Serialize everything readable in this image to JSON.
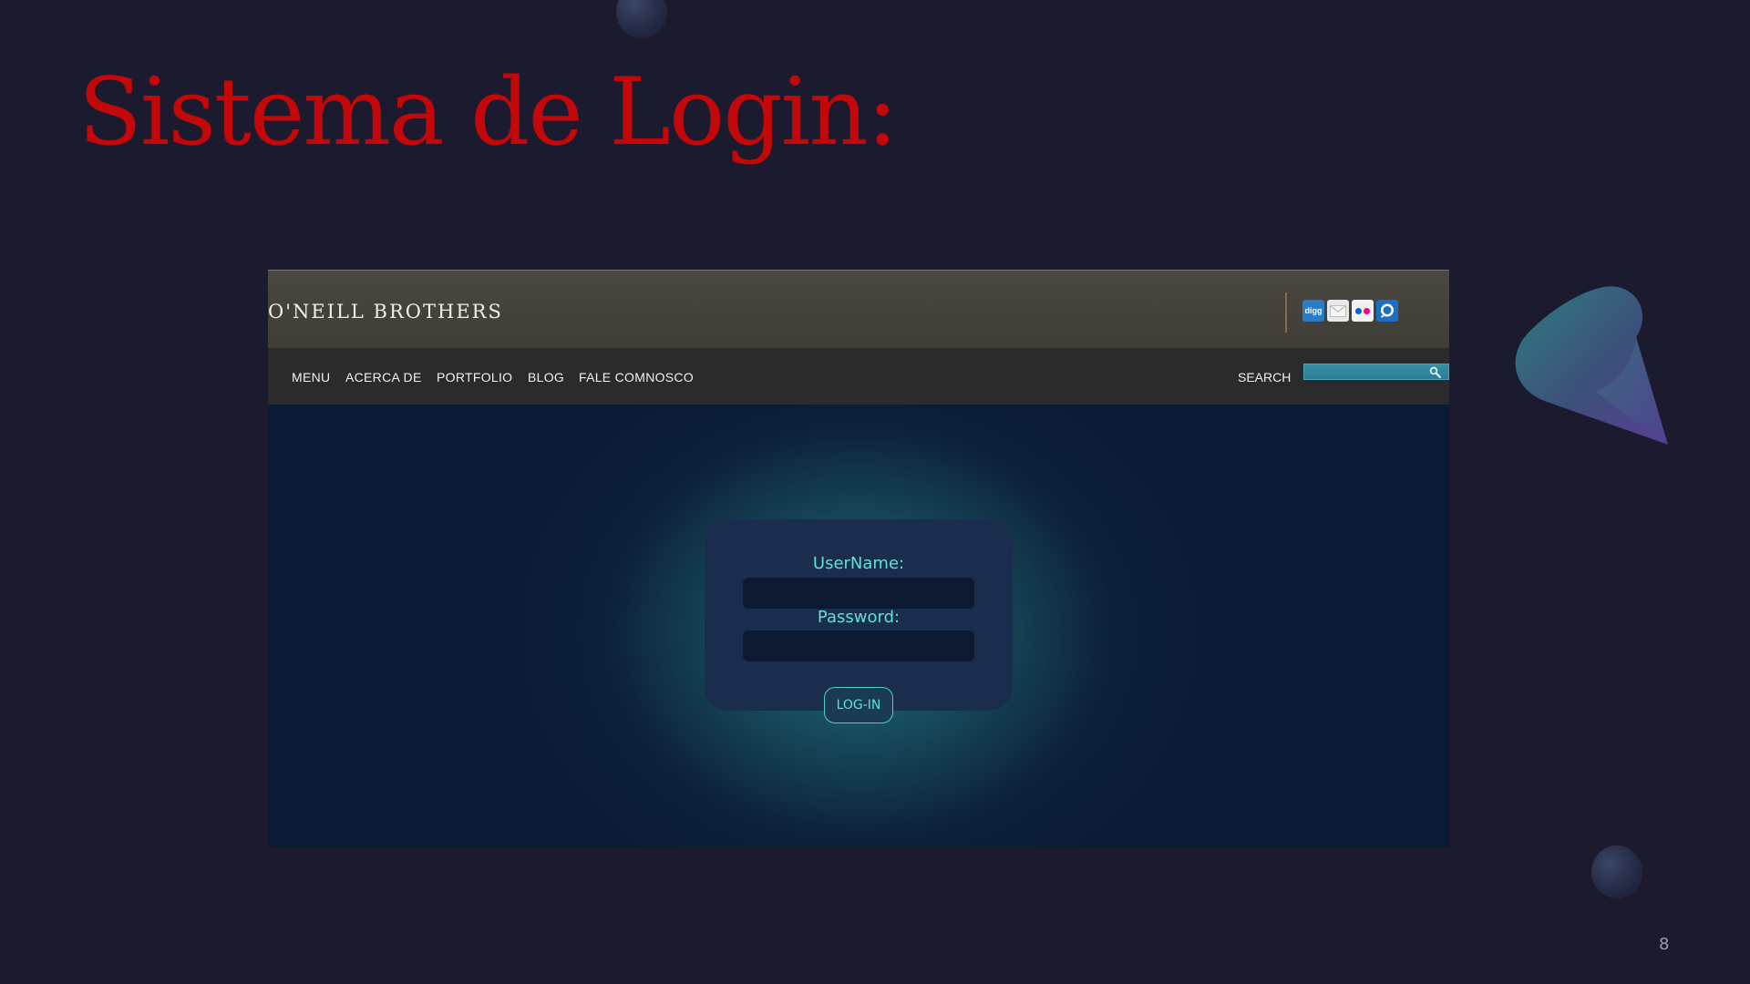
{
  "slide": {
    "title": "Sistema de Login:",
    "page_number": "8"
  },
  "site": {
    "brand": "O'NEILL BROTHERS",
    "social_icons": [
      "digg-icon",
      "mail-icon",
      "flickr-icon",
      "chat-icon"
    ],
    "digg_label": "digg",
    "nav": {
      "items": [
        "MENU",
        "ACERCA DE",
        "PORTFOLIO",
        "BLOG",
        "FALE COMNOSCO"
      ],
      "search_label": "SEARCH",
      "search_value": ""
    },
    "login": {
      "username_label": "UserName:",
      "password_label": "Password:",
      "username_value": "",
      "password_value": "",
      "button_label": "LOG-IN"
    }
  },
  "colors": {
    "slide_background": "#1b1a2e",
    "title": "#c20808",
    "accent_teal": "#5fe2d2",
    "header": "#4a4740",
    "nav": "#2b2b2b",
    "card": "#1b2d4c"
  }
}
